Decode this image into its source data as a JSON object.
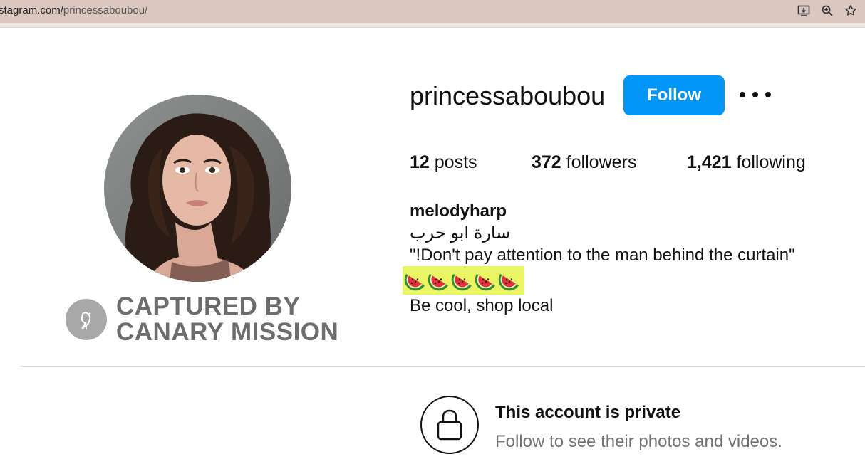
{
  "browser": {
    "url_host": "stagram.com/",
    "url_path": "princessaboubou/",
    "icons": [
      "install-app-icon",
      "zoom-icon",
      "bookmark-star-icon"
    ]
  },
  "profile": {
    "username": "princessaboubou",
    "follow_label": "Follow",
    "more_icon": "more-options-icon",
    "stats": {
      "posts_count": "12",
      "posts_label": "posts",
      "followers_count": "372",
      "followers_label": "followers",
      "following_count": "1,421",
      "following_label": "following"
    },
    "bio": {
      "display_name": "melodyharp",
      "arabic_line": "سارة ابو حرب",
      "quote_line": "\"!Don't pay attention to the man behind the curtain\"",
      "emoji_count": 5,
      "emoji_name": "watermelon-emoji",
      "last_line": "Be cool, shop local"
    }
  },
  "watermark": {
    "line1": "CAPTURED BY",
    "line2": "CANARY MISSION"
  },
  "private_notice": {
    "title": "This account is private",
    "subtitle": "Follow to see their photos and videos."
  },
  "colors": {
    "follow_button": "#0095f6",
    "highlight": "#e9f562",
    "address_bar": "#dcc6c0",
    "watermark_text": "#6d6d6d"
  }
}
